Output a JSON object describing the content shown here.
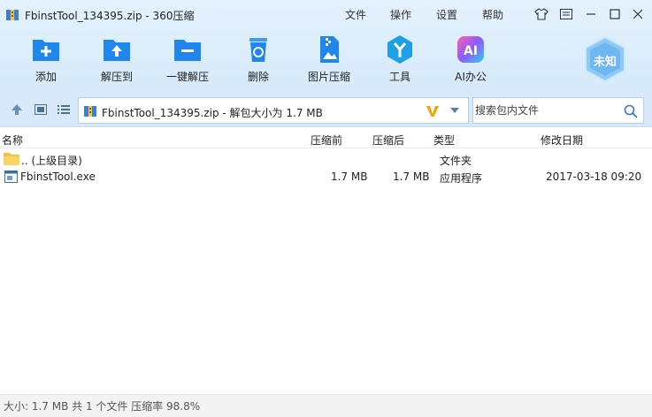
{
  "window": {
    "title": "FbinstTool_134395.zip - 360压缩"
  },
  "menu": {
    "file": "文件",
    "operate": "操作",
    "settings": "设置",
    "help": "帮助"
  },
  "toolbar": {
    "add": "添加",
    "extract_to": "解压到",
    "one_click_extract": "一键解压",
    "delete": "删除",
    "image_compress": "图片压缩",
    "tools": "工具",
    "ai_office": "AI办公"
  },
  "badge": {
    "text": "未知"
  },
  "address": {
    "text": "FbinstTool_134395.zip - 解包大小为 1.7 MB"
  },
  "search": {
    "placeholder": "搜索包内文件"
  },
  "columns": {
    "name": "名称",
    "compressed": "压缩前",
    "uncompressed": "压缩后",
    "type": "类型",
    "modified": "修改日期"
  },
  "files": [
    {
      "name": ".. (上级目录)",
      "size_before": "",
      "size_after": "",
      "type": "文件夹",
      "modified": ""
    },
    {
      "name": "FbinstTool.exe",
      "size_before": "1.7 MB",
      "size_after": "1.7 MB",
      "type": "应用程序",
      "modified": "2017-03-18 09:20"
    }
  ],
  "status": {
    "text": "大小: 1.7 MB 共 1 个文件 压缩率 98.8%"
  },
  "icons": {
    "app_logo": "zip-archive-icon",
    "skin": "shirt-icon",
    "menu": "hamburger-menu-icon",
    "minimize": "minimize-icon",
    "maximize": "maximize-icon",
    "close": "close-icon"
  },
  "colors": {
    "accent": "#2f8bf0",
    "header_bg": "#dcecfb",
    "folder": "#f5c242",
    "badge": "#7cc2f5"
  }
}
